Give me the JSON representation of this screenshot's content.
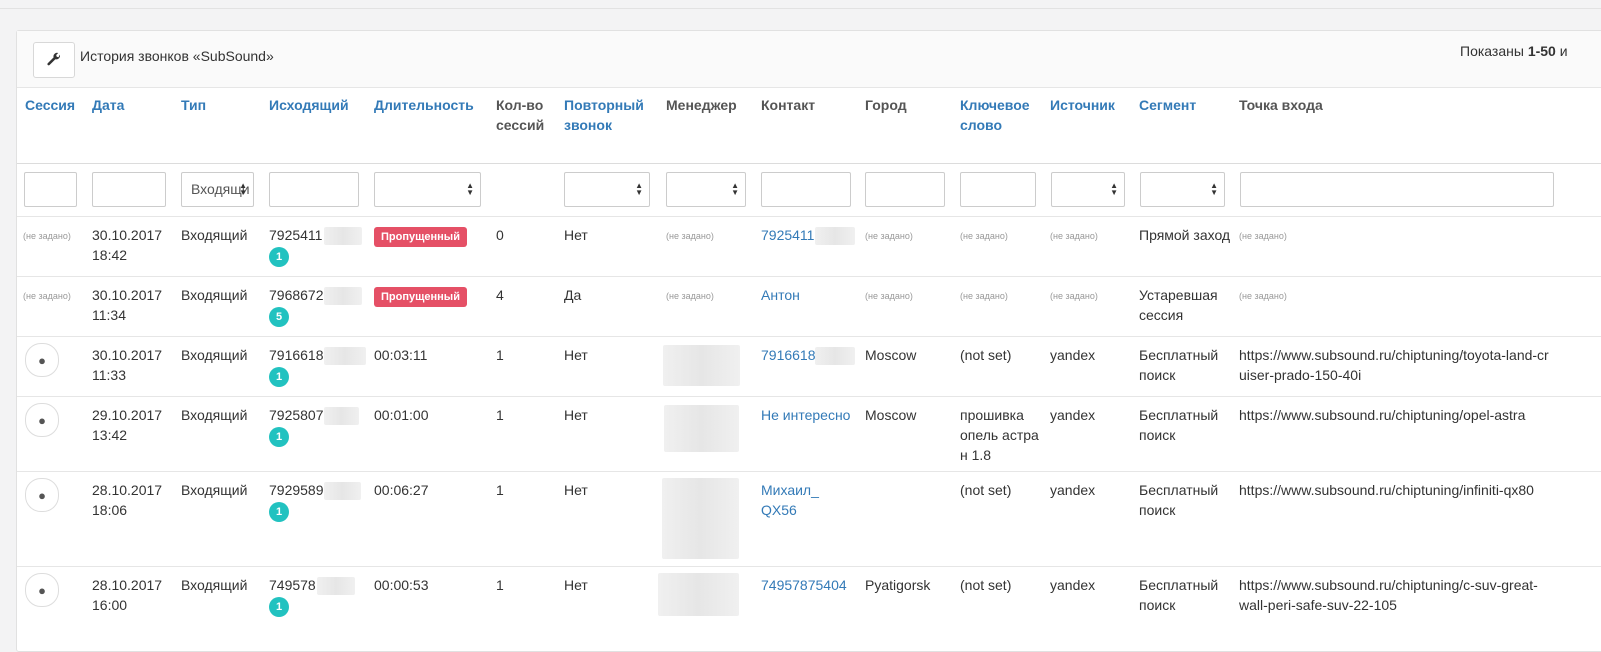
{
  "panel": {
    "title": "История звонков «SubSound»",
    "summary_prefix": "Показаны ",
    "summary_range": "1-50",
    "summary_suffix": " и"
  },
  "columns": [
    "Сессия",
    "Дата",
    "Тип",
    "Исходящий",
    "Длительность",
    "Кол-во сессий",
    "Повторный звонок",
    "Менеджер",
    "Контакт",
    "Город",
    "Ключевое слово",
    "Источник",
    "Сегмент",
    "Точка входа"
  ],
  "filters": {
    "type_value": "Входящий"
  },
  "not_set": "(не задано)",
  "rows": [
    {
      "date": "30.10.2017",
      "time": "18:42",
      "type": "Входящий",
      "phone": "7925411",
      "count_badge": "1",
      "duration": "Пропущенный",
      "duration_missed": true,
      "sessions": "0",
      "repeat": "Нет",
      "manager": "(не задано)",
      "contact": "7925411",
      "city": "(не задано)",
      "keyword": "(не задано)",
      "source": "(не задано)",
      "segment": "Прямой заход",
      "entry": "(не задано)"
    },
    {
      "date": "30.10.2017",
      "time": "11:34",
      "type": "Входящий",
      "phone": "7968672",
      "count_badge": "5",
      "duration": "Пропущенный",
      "duration_missed": true,
      "sessions": "4",
      "repeat": "Да",
      "manager": "(не задано)",
      "contact": "Антон",
      "city": "(не задано)",
      "keyword": "(не задано)",
      "source": "(не задано)",
      "segment": "Устаревшая сессия",
      "entry": "(не задано)"
    },
    {
      "date": "30.10.2017",
      "time": "11:33",
      "type": "Входящий",
      "phone": "7916618",
      "count_badge": "1",
      "duration": "00:03:11",
      "sessions": "1",
      "repeat": "Нет",
      "contact": "7916618",
      "city": "Moscow",
      "keyword": "(not set)",
      "source": "yandex",
      "segment": "Бесплатный поиск",
      "entry": "https://www.subsound.ru/chiptuning/toyota-land-cruiser-prado-150-40i"
    },
    {
      "date": "29.10.2017",
      "time": "13:42",
      "type": "Входящий",
      "phone": "7925807",
      "count_badge": "1",
      "duration": "00:01:00",
      "sessions": "1",
      "repeat": "Нет",
      "contact": "Не интересно",
      "city": "Moscow",
      "keyword": "прошивка опель астра н 1.8",
      "source": "yandex",
      "segment": "Бесплатный поиск",
      "entry": "https://www.subsound.ru/chiptuning/opel-astra"
    },
    {
      "date": "28.10.2017",
      "time": "18:06",
      "type": "Входящий",
      "phone": "7929589",
      "count_badge": "1",
      "duration": "00:06:27",
      "sessions": "1",
      "repeat": "Нет",
      "contact": "Михаил_ QX56",
      "city": "",
      "keyword": "(not set)",
      "source": "yandex",
      "segment": "Бесплатный поиск",
      "entry": "https://www.subsound.ru/chiptuning/infiniti-qx80"
    },
    {
      "date": "28.10.2017",
      "time": "16:00",
      "type": "Входящий",
      "phone": "749578",
      "count_badge": "1",
      "duration": "00:00:53",
      "sessions": "1",
      "repeat": "Нет",
      "contact": "74957875404",
      "city": "Pyatigorsk",
      "keyword": "(not set)",
      "source": "yandex",
      "segment": "Бесплатный поиск",
      "entry": "https://www.subsound.ru/chiptuning/c-suv-great-wall-peri-safe-suv-22-105"
    }
  ],
  "colors": {
    "link": "#337ab7",
    "missed": "#e55066",
    "badge": "#22c2c0"
  }
}
